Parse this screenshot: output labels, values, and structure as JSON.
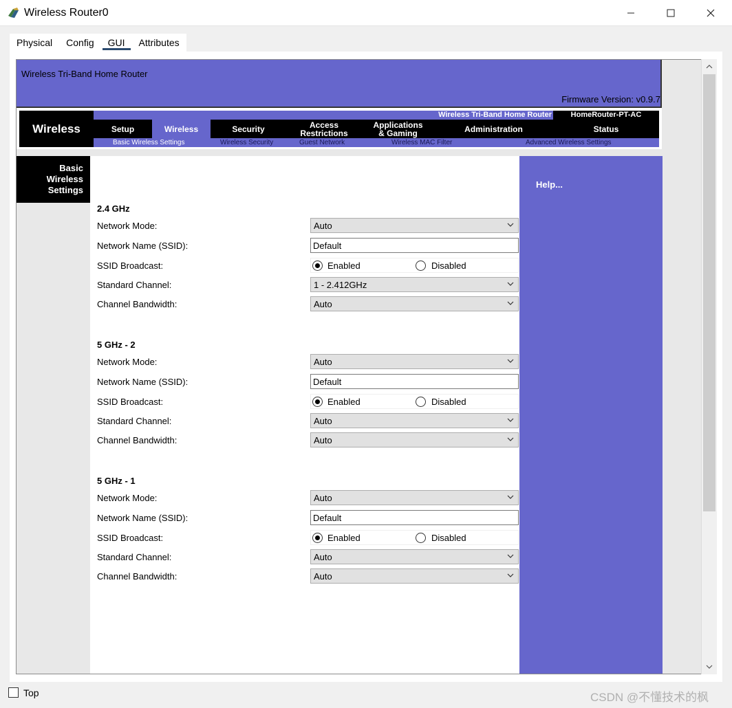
{
  "window": {
    "title": "Wireless Router0",
    "minimize": "—",
    "maximize": "☐",
    "close": "✕"
  },
  "tabs": [
    {
      "label": "Physical"
    },
    {
      "label": "Config"
    },
    {
      "label": "GUI"
    },
    {
      "label": "Attributes"
    }
  ],
  "header": {
    "product_name": "Wireless Tri-Band Home Router",
    "firmware": "Firmware Version: v0.9.7"
  },
  "nav": {
    "title": "Wireless",
    "top_title": "Wireless Tri-Band Home Router",
    "model": "HomeRouter-PT-AC",
    "items": [
      {
        "label": "Setup"
      },
      {
        "label": "Wireless"
      },
      {
        "label": "Security"
      },
      {
        "label": "Access Restrictions",
        "line1": "Access",
        "line2": "Restrictions"
      },
      {
        "label": "Applications & Gaming",
        "line1": "Applications",
        "line2": "& Gaming"
      },
      {
        "label": "Administration"
      },
      {
        "label": "Status"
      }
    ],
    "subnav": [
      {
        "label": "Basic Wireless Settings"
      },
      {
        "label": "Wireless Security"
      },
      {
        "label": "Guest Network"
      },
      {
        "label": "Wireless MAC Filter"
      },
      {
        "label": "Advanced Wireless Settings"
      }
    ]
  },
  "left_title": {
    "line1": "Basic",
    "line2": "Wireless",
    "line3": "Settings"
  },
  "help": {
    "label": "Help..."
  },
  "labels": {
    "network_mode": "Network Mode:",
    "network_name": "Network Name (SSID):",
    "ssid_broadcast": "SSID Broadcast:",
    "standard_channel": "Standard Channel:",
    "channel_bandwidth": "Channel Bandwidth:",
    "enabled": "Enabled",
    "disabled": "Disabled"
  },
  "sections": [
    {
      "title": "2.4 GHz",
      "network_mode": "Auto",
      "ssid": "Default",
      "ssid_broadcast": "Enabled",
      "standard_channel": "1 - 2.412GHz",
      "channel_bandwidth": "Auto"
    },
    {
      "title": "5 GHz - 2",
      "network_mode": "Auto",
      "ssid": "Default",
      "ssid_broadcast": "Enabled",
      "standard_channel": "Auto",
      "channel_bandwidth": "Auto"
    },
    {
      "title": "5 GHz - 1",
      "network_mode": "Auto",
      "ssid": "Default",
      "ssid_broadcast": "Enabled",
      "standard_channel": "Auto",
      "channel_bandwidth": "Auto"
    }
  ],
  "bottom": {
    "top_label": "Top",
    "top_checked": false,
    "watermark": "CSDN @不懂技术的枫"
  },
  "colors": {
    "router_purple": "#6666cc",
    "nav_black": "#000000",
    "content_bg": "#ffffff",
    "side_grey": "#e8e8e8"
  }
}
